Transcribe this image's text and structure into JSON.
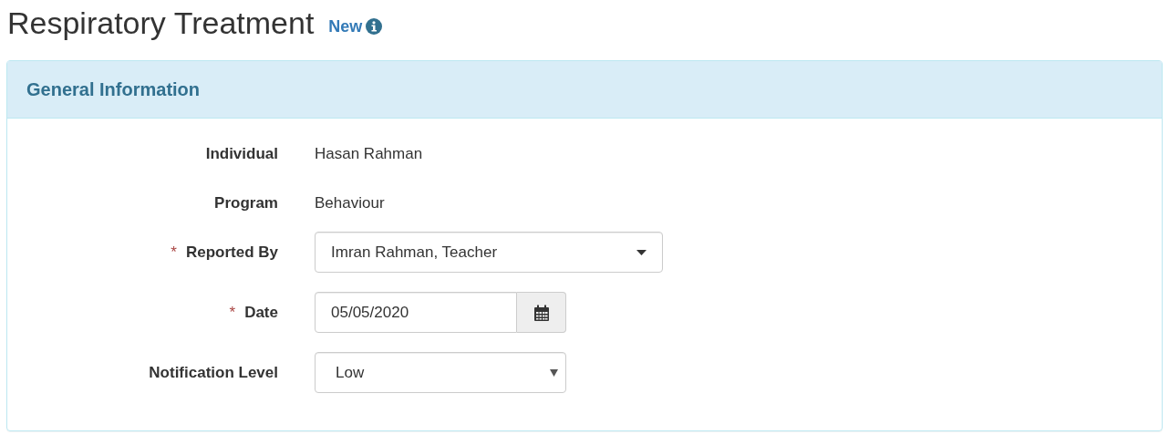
{
  "page": {
    "title": "Respiratory Treatment",
    "status": "New"
  },
  "panel": {
    "title": "General Information",
    "fields": [
      {
        "kind": "static",
        "label": "Individual",
        "value": "Hasan Rahman"
      },
      {
        "kind": "static",
        "label": "Program",
        "value": "Behaviour"
      },
      {
        "kind": "dropdown",
        "label": "Reported By",
        "required_mark": "*",
        "value": "Imran Rahman, Teacher"
      },
      {
        "kind": "date",
        "label": "Date",
        "required_mark": "*",
        "value": "05/05/2020"
      },
      {
        "kind": "select",
        "label": "Notification Level",
        "value": "Low"
      }
    ]
  }
}
